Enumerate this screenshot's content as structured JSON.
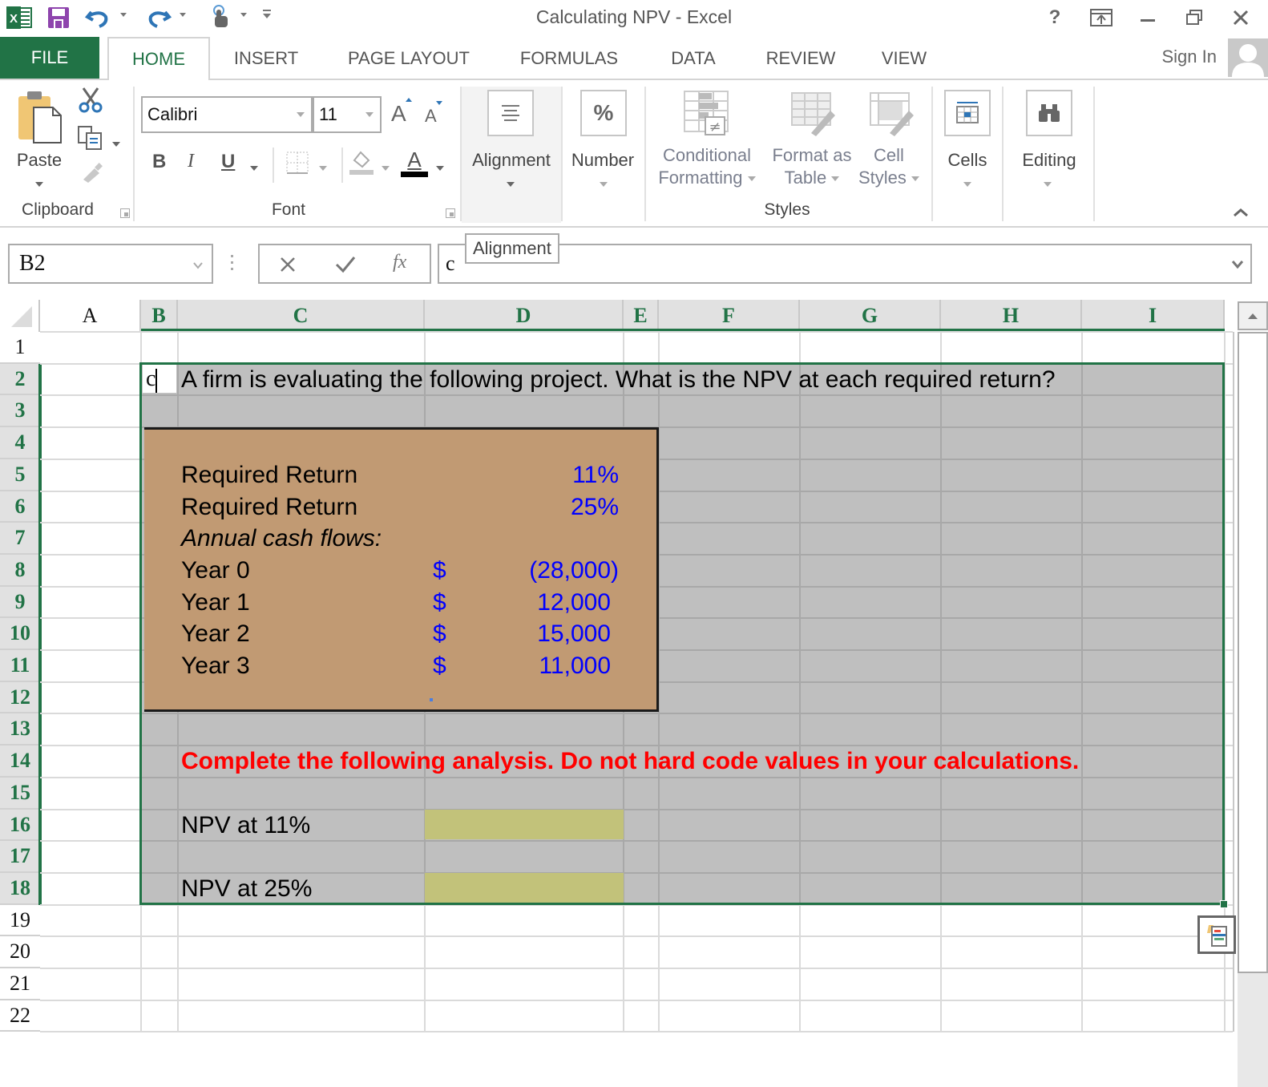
{
  "window": {
    "title": "Calculating NPV - Excel",
    "help": "?",
    "buttons": [
      "ribbon-display-options",
      "minimize",
      "restore",
      "close"
    ]
  },
  "quick_access": [
    "excel-logo",
    "save",
    "undo",
    "redo",
    "touch-mode",
    "customize"
  ],
  "tabs": [
    {
      "label": "FILE"
    },
    {
      "label": "HOME",
      "active": true
    },
    {
      "label": "INSERT"
    },
    {
      "label": "PAGE LAYOUT"
    },
    {
      "label": "FORMULAS"
    },
    {
      "label": "DATA"
    },
    {
      "label": "REVIEW"
    },
    {
      "label": "VIEW"
    }
  ],
  "account": {
    "sign_in": "Sign In"
  },
  "ribbon": {
    "clipboard": {
      "group": "Clipboard",
      "paste": "Paste"
    },
    "font": {
      "group": "Font",
      "font_name": "Calibri",
      "font_size": "11",
      "bold": "B",
      "italic": "I",
      "underline": "U",
      "font_color_glyph": "A",
      "grow": "A",
      "shrink": "A"
    },
    "alignment": {
      "label": "Alignment"
    },
    "number": {
      "label": "Number",
      "glyph": "%"
    },
    "styles": {
      "group": "Styles",
      "conditional": [
        "Conditional",
        "Formatting"
      ],
      "format_table": [
        "Format as",
        "Table"
      ],
      "cell_styles": [
        "Cell",
        "Styles"
      ]
    },
    "cells": {
      "label": "Cells"
    },
    "editing": {
      "label": "Editing"
    }
  },
  "formula_bar": {
    "name_box": "B2",
    "content": "c",
    "tooltip": "Alignment",
    "fx": "fx"
  },
  "sheet": {
    "columns": [
      "A",
      "B",
      "C",
      "D",
      "E",
      "F",
      "G",
      "H",
      "I"
    ],
    "rows": [
      "1",
      "2",
      "3",
      "4",
      "5",
      "6",
      "7",
      "8",
      "9",
      "10",
      "11",
      "12",
      "13",
      "14",
      "15",
      "16",
      "17",
      "18",
      "19",
      "20",
      "21",
      "22"
    ],
    "selected_range": "B2:I18",
    "active_cell": "B2",
    "b2_editing": "c",
    "prompt": "A firm is evaluating the following project. What is the NPV at each required return?",
    "inputs": {
      "rate1_label": "Required Return",
      "rate1": "11%",
      "rate2_label": "Required Return",
      "rate2": "25%",
      "cashflows_label": "Annual cash flows:",
      "cashflows": [
        {
          "label": "Year 0",
          "currency": "$",
          "value": "(28,000)"
        },
        {
          "label": "Year 1",
          "currency": "$",
          "value": "12,000"
        },
        {
          "label": "Year 2",
          "currency": "$",
          "value": "15,000"
        },
        {
          "label": "Year 3",
          "currency": "$",
          "value": "11,000"
        }
      ]
    },
    "instruction": "Complete the following analysis. Do not hard code values in your calculations.",
    "outputs": [
      {
        "label": "NPV at 11%",
        "value": ""
      },
      {
        "label": "NPV at 25%",
        "value": ""
      }
    ]
  },
  "colors": {
    "excel_green": "#217346",
    "input_box": "#c19a73",
    "selection_fill": "#bfbfbf",
    "answer_cell": "#c2c27a",
    "instruction_red": "#ff0000",
    "input_blue": "#0000ff"
  }
}
